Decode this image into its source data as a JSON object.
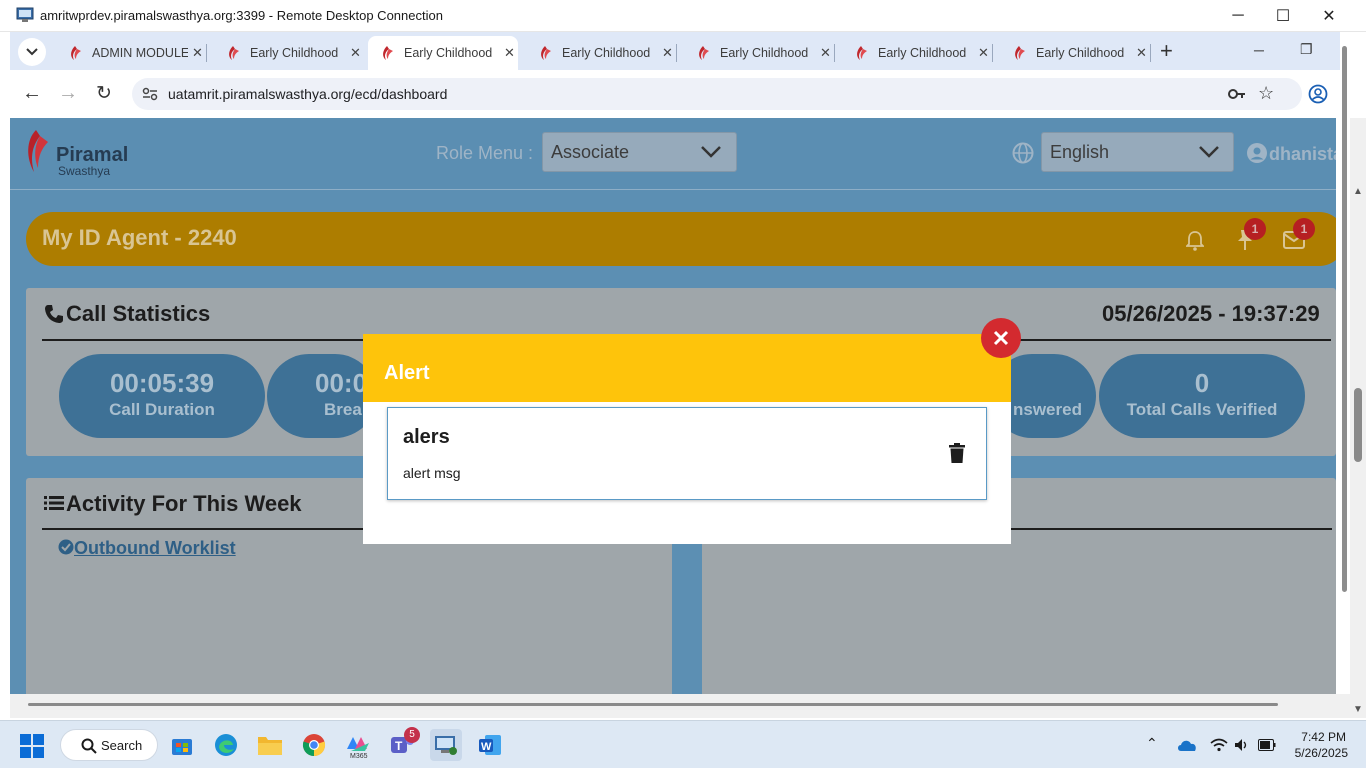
{
  "rdp": {
    "title": "amritwprdev.piramalswasthya.org:3399 - Remote Desktop Connection",
    "minimize": "─",
    "maximize": "☐",
    "close": "✕"
  },
  "browser": {
    "tabs": [
      {
        "label": "ADMIN MODULE",
        "active": false
      },
      {
        "label": "Early Childhood",
        "active": false
      },
      {
        "label": "Early Childhood",
        "active": true
      },
      {
        "label": "Early Childhood",
        "active": false
      },
      {
        "label": "Early Childhood",
        "active": false
      },
      {
        "label": "Early Childhood",
        "active": false
      },
      {
        "label": "Early Childhood",
        "active": false
      }
    ],
    "new_tab": "+",
    "url": "uatamrit.piramalswasthya.org/ecd/dashboard"
  },
  "app": {
    "logo_name": "Piramal",
    "logo_sub": "Swasthya",
    "role_menu_label": "Role Menu :",
    "role_value": "Associate",
    "language_value": "English",
    "username": "dhanista",
    "agent_label": "My ID Agent - 2240",
    "pin_count": "1",
    "mail_count": "1"
  },
  "call_statistics": {
    "title": "Call Statistics",
    "datetime": "05/26/2025 - 19:37:29",
    "stats": [
      {
        "value": "00:05:39",
        "label": "Call Duration"
      },
      {
        "value": "00:0",
        "label": "Brea"
      },
      {
        "value": "",
        "label": "nswered"
      },
      {
        "value": "0",
        "label": "Total Calls Verified"
      }
    ]
  },
  "activity": {
    "title": "Activity For This Week",
    "link": "Outbound Worklist"
  },
  "modal": {
    "title": "Alert",
    "alert_title": "alers",
    "alert_message": "alert msg"
  },
  "taskbar": {
    "search_label": "Search",
    "teams_badge": "5",
    "m365_label": "M365",
    "time": "7:42 PM",
    "date": "5/26/2025"
  },
  "colors": {
    "agent_bar": "#ad7d00",
    "modal_header": "#fec40b",
    "close_button": "#d32a2f",
    "page_bg": "#5c8fb3"
  }
}
